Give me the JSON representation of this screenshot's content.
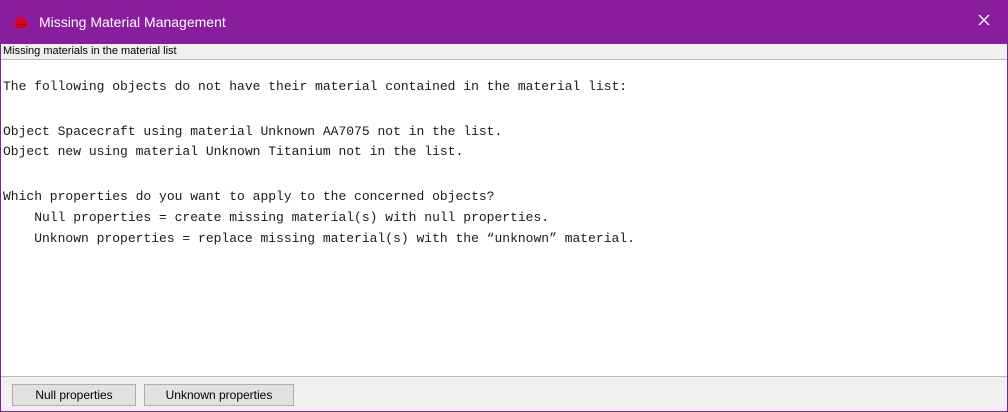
{
  "window": {
    "title": "Missing Material Management",
    "title_bar_color": "#8a1c9e",
    "app_icon": "red-hat-icon",
    "close_icon": "close-icon"
  },
  "subheader": {
    "text": "Missing materials in the material list"
  },
  "message": {
    "intro": "The following objects do not have their material contained in the material list:",
    "objects": [
      "Object Spacecraft using material Unknown AA7075 not in the list.",
      "Object new using material Unknown Titanium not in the list."
    ],
    "question": "Which properties do you want to apply to the concerned objects?",
    "options": [
      "    Null properties = create missing material(s) with null properties.",
      "    Unknown properties = replace missing material(s) with the “unknown” material."
    ]
  },
  "buttons": {
    "null_label": "Null properties",
    "unknown_label": "Unknown properties"
  }
}
